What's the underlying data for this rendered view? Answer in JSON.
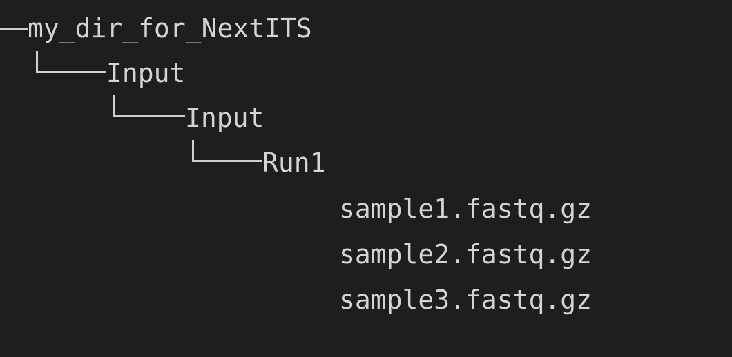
{
  "tree": {
    "root": "my_dir_for_NextITS",
    "level1": "Input",
    "level2": "Input",
    "level3": "Run1",
    "files": [
      "sample1.fastq.gz",
      "sample2.fastq.gz",
      "sample3.fastq.gz"
    ]
  }
}
